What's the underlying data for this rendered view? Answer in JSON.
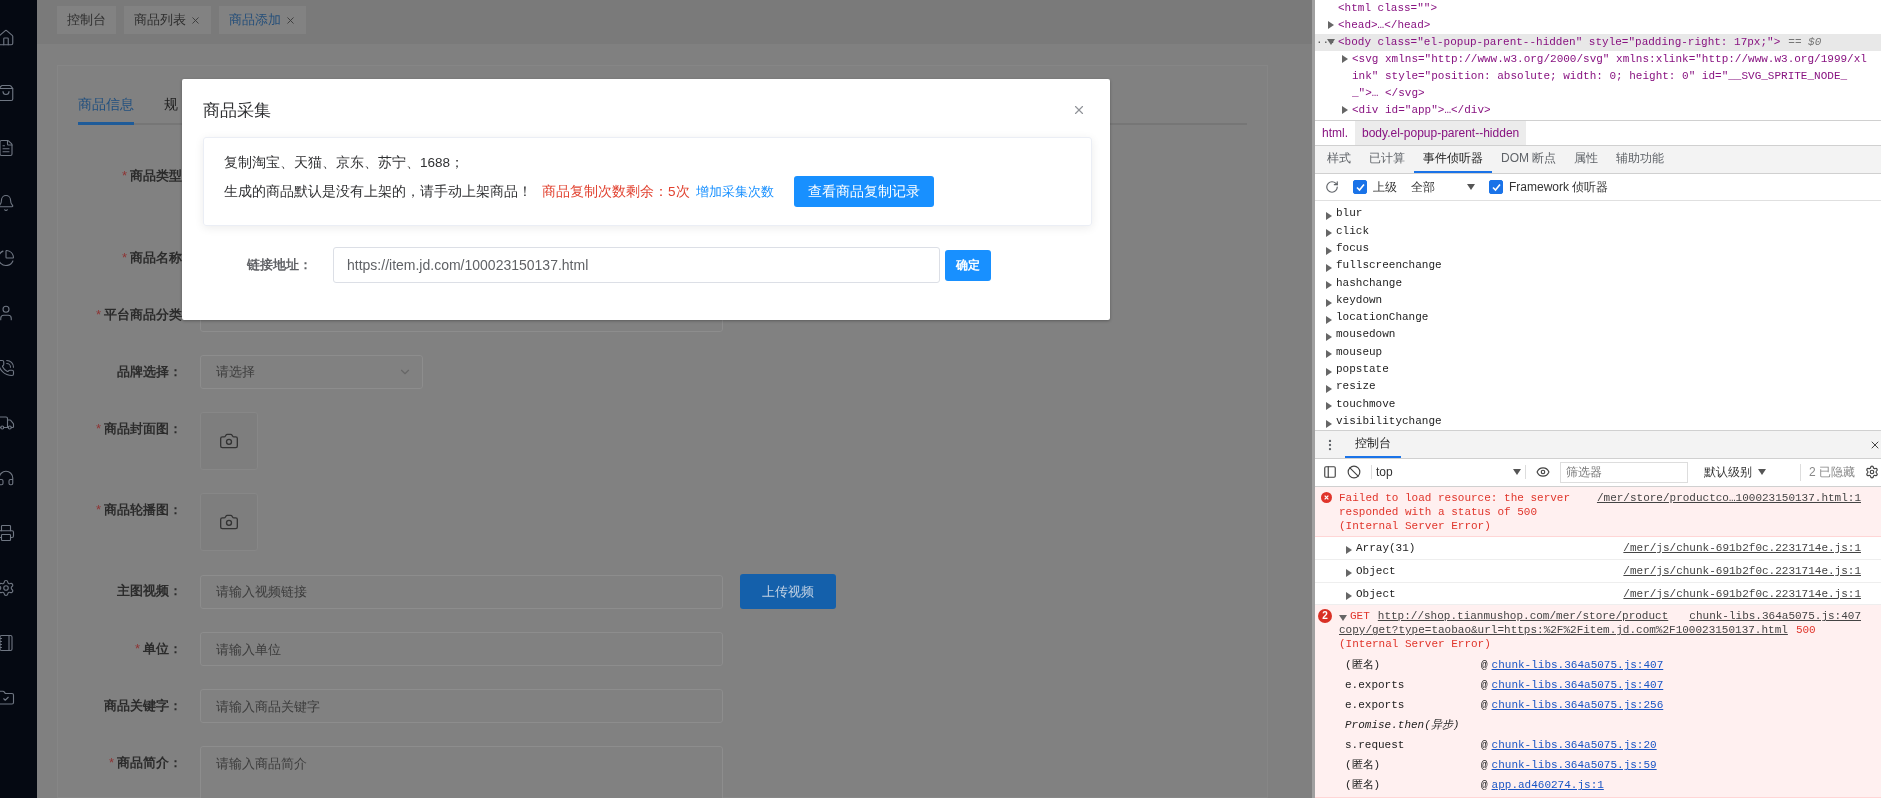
{
  "tags": [
    {
      "label": "控制台",
      "closable": false,
      "selected": false
    },
    {
      "label": "商品列表",
      "closable": true,
      "selected": false
    },
    {
      "label": "商品添加",
      "closable": true,
      "selected": true
    }
  ],
  "form_tabs": [
    {
      "label": "商品信息",
      "selected": true
    },
    {
      "label": "规",
      "selected": false
    }
  ],
  "form_rows": [
    {
      "label": "商品类型",
      "required_mark": "*",
      "kind": "covered_tall"
    },
    {
      "label": "商品名称",
      "required_mark": "*",
      "kind": "covered"
    },
    {
      "label": "平台商品分类",
      "required_mark": "*",
      "kind": "input"
    },
    {
      "label": "品牌选择：",
      "kind": "select",
      "placeholder": "请选择"
    },
    {
      "label": "商品封面图：",
      "required_mark": "*",
      "kind": "upload"
    },
    {
      "label": "商品轮播图：",
      "required_mark": "*",
      "kind": "upload"
    },
    {
      "label": "主图视频：",
      "kind": "input",
      "placeholder": "请输入视频链接",
      "button": "上传视频"
    },
    {
      "label": "单位：",
      "required_mark": "*",
      "kind": "input",
      "placeholder": "请输入单位"
    },
    {
      "label": "商品关键字：",
      "kind": "input",
      "placeholder": "请输入商品关键字"
    },
    {
      "label": "商品简介：",
      "required_mark": "*",
      "kind": "textarea",
      "placeholder": "请输入商品简介"
    }
  ],
  "dialog": {
    "title": "商品采集",
    "intro": "复制淘宝、天猫、京东、苏宁、1688；",
    "notice": "生成的商品默认是没有上架的，请手动上架商品！",
    "remaining": "商品复制次数剩余：5次",
    "add_link": "增加采集次数",
    "record_button": "查看商品复制记录",
    "url_label": "链接地址：",
    "url_value": "https://item.jd.com/100023150137.html",
    "confirm_button": "确定"
  },
  "devtools": {
    "dom_lines": [
      {
        "text": "<html class=\"\">",
        "selected": false
      },
      {
        "text": "<head>…</head>",
        "expanded": false,
        "selected": false
      },
      {
        "text": "<body class=\"el-popup-parent--hidden\" style=\"padding-right: 17px;\">",
        "expanded": true,
        "selected": true,
        "marker": "···",
        "suffix": "== $0"
      },
      {
        "text": "<svg xmlns=\"http://www.w3.org/2000/svg\" xmlns:xlink=\"http://www.w3.org/1999/xlink\" style=\"position: absolute; width: 0; height: 0\" id=\"__SVG_SPRITE_NODE__\">… </svg>",
        "expanded": false,
        "selected": false,
        "nested": true
      },
      {
        "text": "<div id=\"app\">…</div>",
        "expanded": false,
        "selected": false,
        "nested": true
      }
    ],
    "breadcrumbs": [
      {
        "label": "html.",
        "selected": false
      },
      {
        "label": "body.el-popup-parent--hidden",
        "selected": true
      }
    ],
    "panel_tabs": [
      {
        "label": "样式",
        "selected": false
      },
      {
        "label": "已计算",
        "selected": false
      },
      {
        "label": "事件侦听器",
        "selected": true
      },
      {
        "label": "DOM 断点",
        "selected": false
      },
      {
        "label": "属性",
        "selected": false
      },
      {
        "label": "辅助功能",
        "selected": false
      }
    ],
    "listener_toolbar": {
      "ancestors": {
        "label": "上级",
        "checked": true
      },
      "filter": "全部",
      "framework": {
        "label": "Framework 侦听器",
        "checked": true
      }
    },
    "events": [
      "blur",
      "click",
      "focus",
      "fullscreenchange",
      "hashchange",
      "keydown",
      "locationChange",
      "mousedown",
      "mouseup",
      "popstate",
      "resize",
      "touchmove",
      "visibilitychange"
    ],
    "drawer_tabs": [
      {
        "label": "控制台",
        "selected": true
      }
    ],
    "console_toolbar": {
      "context": "top",
      "filter_placeholder": "筛选器",
      "levels": "默认级别",
      "hidden": "2 已隐藏"
    },
    "messages": [
      {
        "kind": "error",
        "text": "Failed to load resource: the server responded with a status of 500 (Internal Server Error)",
        "source": "/mer/store/productco…100023150137.html:1"
      },
      {
        "kind": "log",
        "text": "Array(31)",
        "source": "/mer/js/chunk-691b2f0c.2231714e.js:1"
      },
      {
        "kind": "log",
        "text": "Object",
        "source": "/mer/js/chunk-691b2f0c.2231714e.js:1"
      },
      {
        "kind": "log",
        "text": "Object",
        "source": "/mer/js/chunk-691b2f0c.2231714e.js:1"
      },
      {
        "kind": "network_error",
        "count": "2",
        "method": "GET",
        "url_lines": [
          "http://shop.tianmushop.com/mer/store/product",
          "copy/get?type=taobao&url=https:%2F%2Fitem.jd.com%2F100023150137.html"
        ],
        "status": "500",
        "status_text": "(Internal Server Error)",
        "source": "chunk-libs.364a5075.js:407",
        "stack": [
          {
            "fn": "(匿名)",
            "at": "@",
            "location": "chunk-libs.364a5075.js:407"
          },
          {
            "fn": "e.exports",
            "at": "@",
            "location": "chunk-libs.364a5075.js:407"
          },
          {
            "fn": "e.exports",
            "at": "@",
            "location": "chunk-libs.364a5075.js:256"
          },
          {
            "fn": "Promise.then(异步)",
            "kind": "async"
          },
          {
            "fn": "s.request",
            "at": "@",
            "location": "chunk-libs.364a5075.js:20"
          },
          {
            "fn": "(匿名)",
            "at": "@",
            "location": "chunk-libs.364a5075.js:59"
          },
          {
            "fn": "(匿名)",
            "at": "@",
            "location": "app.ad460274.js:1"
          }
        ]
      }
    ]
  }
}
